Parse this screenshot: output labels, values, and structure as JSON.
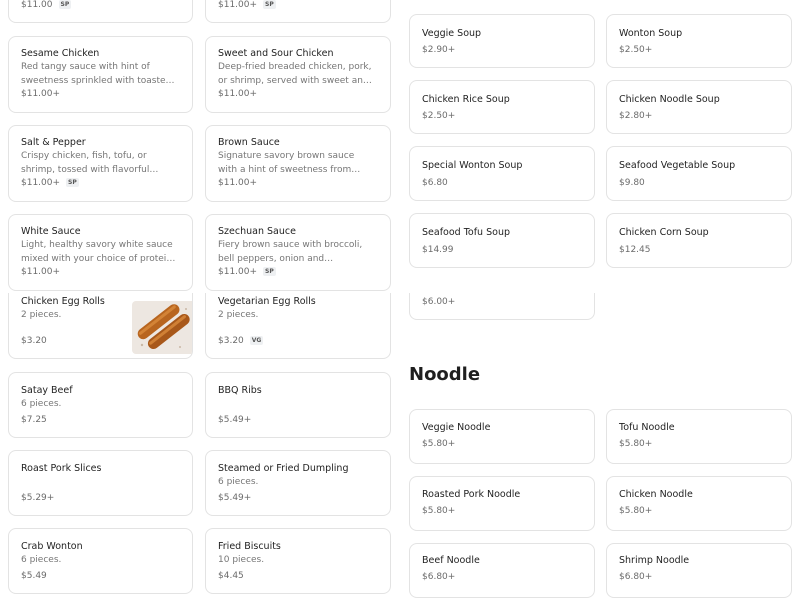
{
  "left_menu": {
    "top_partial": [
      {
        "price": "$11.00",
        "badge": "SP"
      },
      {
        "price": "$11.00+",
        "badge": "SP"
      }
    ],
    "entrees": [
      {
        "name": "Sesame Chicken",
        "desc": "Red tangy sauce with hint of sweetness sprinkled with toasted sesame seeds.",
        "price": "$11.00+",
        "badge": ""
      },
      {
        "name": "Sweet and Sour Chicken",
        "desc": "Deep-fried breaded chicken, pork, or shrimp, served with sweet and tart sauce.",
        "price": "$11.00+",
        "badge": ""
      },
      {
        "name": "Salt & Pepper",
        "desc": "Crispy chicken, fish, tofu, or shrimp, tossed with flavorful onion, jalapeno, and garlic.",
        "price": "$11.00+",
        "badge": "SP"
      },
      {
        "name": "Brown Sauce",
        "desc": "Signature savory brown sauce with a hint of sweetness from house-blended spices.",
        "price": "$11.00+",
        "badge": ""
      },
      {
        "name": "White Sauce",
        "desc": "Light, healthy savory white sauce mixed with your choice of protein and vegetables.",
        "price": "$11.00+",
        "badge": ""
      },
      {
        "name": "Szechuan Sauce",
        "desc": "Fiery brown sauce with broccoli, bell peppers, onion and mushroom.",
        "price": "$11.00+",
        "badge": "SP"
      }
    ],
    "appetizers": [
      {
        "name": "Chicken Egg Rolls",
        "desc": "2 pieces.",
        "price": "$3.20",
        "badge": "",
        "image": "egg-rolls-photo"
      },
      {
        "name": "Vegetarian Egg Rolls",
        "desc": "2 pieces.",
        "price": "$3.20",
        "badge": "VG"
      },
      {
        "name": "Satay Beef",
        "desc": "6 pieces.",
        "price": "$7.25",
        "badge": ""
      },
      {
        "name": "BBQ Ribs",
        "desc": "",
        "price": "$5.49+",
        "badge": ""
      },
      {
        "name": "Roast Pork Slices",
        "desc": "",
        "price": "$5.29+",
        "badge": ""
      },
      {
        "name": "Steamed or Fried Dumpling",
        "desc": "6 pieces.",
        "price": "$5.49+",
        "badge": ""
      },
      {
        "name": "Crab Wonton",
        "desc": "6 pieces.",
        "price": "$5.49",
        "badge": ""
      },
      {
        "name": "Fried Biscuits",
        "desc": "10 pieces.",
        "price": "$4.45",
        "badge": ""
      }
    ]
  },
  "right_menu": {
    "soups": [
      {
        "name": "Veggie Soup",
        "price": "$2.90+"
      },
      {
        "name": "Wonton Soup",
        "price": "$2.50+"
      },
      {
        "name": "Chicken Rice Soup",
        "price": "$2.50+"
      },
      {
        "name": "Chicken Noodle Soup",
        "price": "$2.80+"
      },
      {
        "name": "Special Wonton Soup",
        "price": "$6.80"
      },
      {
        "name": "Seafood Vegetable Soup",
        "price": "$9.80"
      },
      {
        "name": "Seafood Tofu Soup",
        "price": "$14.99"
      },
      {
        "name": "Chicken Corn Soup",
        "price": "$12.45"
      }
    ],
    "partial_price": "$6.00+",
    "noodle_heading": "Noodle",
    "noodles": [
      {
        "name": "Veggie Noodle",
        "price": "$5.80+"
      },
      {
        "name": "Tofu Noodle",
        "price": "$5.80+"
      },
      {
        "name": "Roasted Pork Noodle",
        "price": "$5.80+"
      },
      {
        "name": "Chicken Noodle",
        "price": "$5.80+"
      },
      {
        "name": "Beef Noodle",
        "price": "$6.80+"
      },
      {
        "name": "Shrimp Noodle",
        "price": "$6.80+"
      }
    ]
  }
}
